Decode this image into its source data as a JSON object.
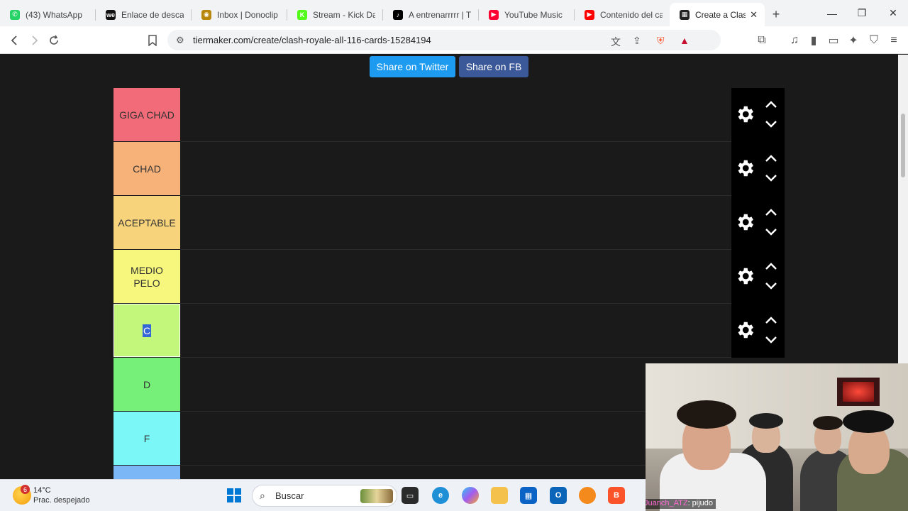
{
  "tabs": [
    {
      "title": "(43) WhatsApp",
      "icon": "whatsapp-icon",
      "color": "#25d366",
      "glyph": "✆"
    },
    {
      "title": "Enlace de descarg",
      "icon": "wetransfer-icon",
      "color": "#111111",
      "glyph": "we"
    },
    {
      "title": "Inbox | Donoclip",
      "icon": "donoclip-icon",
      "color": "#b8860b",
      "glyph": "◉"
    },
    {
      "title": "Stream - Kick Das",
      "icon": "kick-icon",
      "color": "#53fc18",
      "glyph": "K"
    },
    {
      "title": "A entrenarrrrr | Ti",
      "icon": "tiktok-icon",
      "color": "#000000",
      "glyph": "♪"
    },
    {
      "title": "YouTube Music",
      "icon": "youtube-music-icon",
      "color": "#ff0033",
      "glyph": "▶"
    },
    {
      "title": "Contenido del car",
      "icon": "youtube-studio-icon",
      "color": "#ff0000",
      "glyph": "▶"
    },
    {
      "title": "Create a Clas",
      "icon": "tiermaker-icon",
      "color": "#222222",
      "glyph": "▦",
      "active": true
    }
  ],
  "browser": {
    "url": "tiermaker.com/create/clash-royale-all-116-cards-15284194"
  },
  "share": {
    "twitter": "Share on Twitter",
    "facebook": "Share on FB"
  },
  "tiers": [
    {
      "label": "GIGA CHAD",
      "color": "#f26b79"
    },
    {
      "label": "CHAD",
      "color": "#f7b27a"
    },
    {
      "label": "ACEPTABLE",
      "color": "#f7d37b"
    },
    {
      "label": "MEDIO PELO",
      "color": "#f6f77c"
    },
    {
      "label": "C",
      "color": "#c3f77b",
      "selected": true
    },
    {
      "label": "D",
      "color": "#77f07a"
    },
    {
      "label": "F",
      "color": "#7bf7f7"
    }
  ],
  "webcam": {
    "caption_user": "Juanch_ATZ",
    "caption_text": ": pijudo"
  },
  "taskbar": {
    "weather_badge": "6",
    "temperature": "14°C",
    "condition": "Prac. despejado",
    "search_placeholder": "Buscar"
  }
}
